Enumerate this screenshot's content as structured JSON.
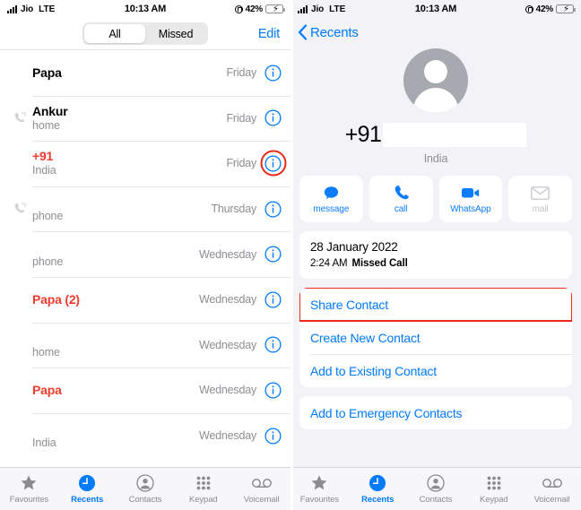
{
  "status_bar": {
    "carrier": "Jio",
    "network": "LTE",
    "time": "10:13 AM",
    "battery_percent": "42%",
    "battery_level": 42,
    "charging": true,
    "lock_icon": "rotation-lock-icon"
  },
  "left_screen": {
    "segmented": {
      "options": [
        "All",
        "Missed"
      ],
      "selected": "All"
    },
    "edit_label": "Edit",
    "calls": [
      {
        "name": "Papa",
        "subtitle": "",
        "when": "Friday",
        "missed": false,
        "outgoing": false,
        "redacted": false,
        "highlighted": false
      },
      {
        "name": "Ankur",
        "subtitle": "home",
        "when": "Friday",
        "missed": false,
        "outgoing": true,
        "redacted": false,
        "highlighted": false
      },
      {
        "name": "+91",
        "subtitle": "India",
        "when": "Friday",
        "missed": true,
        "outgoing": false,
        "redacted": false,
        "highlighted": true
      },
      {
        "name": "",
        "subtitle": "phone",
        "when": "Thursday",
        "missed": false,
        "outgoing": true,
        "redacted": true,
        "highlighted": false
      },
      {
        "name": "",
        "subtitle": "phone",
        "when": "Wednesday",
        "missed": false,
        "outgoing": false,
        "redacted": true,
        "highlighted": false
      },
      {
        "name": "Papa (2)",
        "subtitle": "",
        "when": "Wednesday",
        "missed": true,
        "outgoing": false,
        "redacted": false,
        "highlighted": false
      },
      {
        "name": "",
        "subtitle": "home",
        "when": "Wednesday",
        "missed": false,
        "outgoing": false,
        "redacted": true,
        "highlighted": false
      },
      {
        "name": "Papa",
        "subtitle": "",
        "when": "Wednesday",
        "missed": true,
        "outgoing": false,
        "redacted": false,
        "highlighted": false
      },
      {
        "name": "",
        "subtitle": "India",
        "when": "Wednesday",
        "missed": false,
        "outgoing": false,
        "redacted": true,
        "highlighted": false
      }
    ]
  },
  "right_screen": {
    "back_label": "Recents",
    "contact": {
      "country_code": "+91",
      "number_redacted": true,
      "region": "India",
      "avatar_icon": "person-placeholder-icon"
    },
    "actions": [
      {
        "label": "message",
        "icon": "message-bubble-icon",
        "enabled": true
      },
      {
        "label": "call",
        "icon": "phone-handset-icon",
        "enabled": true
      },
      {
        "label": "WhatsApp",
        "icon": "video-camera-icon",
        "enabled": true
      },
      {
        "label": "mail",
        "icon": "envelope-icon",
        "enabled": false
      }
    ],
    "call_detail": {
      "date": "28 January 2022",
      "time": "2:24 AM",
      "type": "Missed Call"
    },
    "options": [
      {
        "label": "Share Contact",
        "highlighted": true
      },
      {
        "label": "Create New Contact",
        "highlighted": false
      },
      {
        "label": "Add to Existing Contact",
        "highlighted": false
      }
    ],
    "emergency": {
      "label": "Add to Emergency Contacts"
    }
  },
  "tab_bar": {
    "items": [
      {
        "label": "Favourites",
        "icon": "star-icon",
        "active": false
      },
      {
        "label": "Recents",
        "icon": "clock-icon",
        "active": true
      },
      {
        "label": "Contacts",
        "icon": "person-circle-icon",
        "active": false
      },
      {
        "label": "Keypad",
        "icon": "keypad-grid-icon",
        "active": false
      },
      {
        "label": "Voicemail",
        "icon": "voicemail-icon",
        "active": false
      }
    ]
  },
  "colors": {
    "ios_blue": "#007aff",
    "missed_red": "#f03c2e",
    "highlight_red": "#e8291c",
    "gray_text": "#8e8e93",
    "page_bg": "#f2f2f7"
  }
}
